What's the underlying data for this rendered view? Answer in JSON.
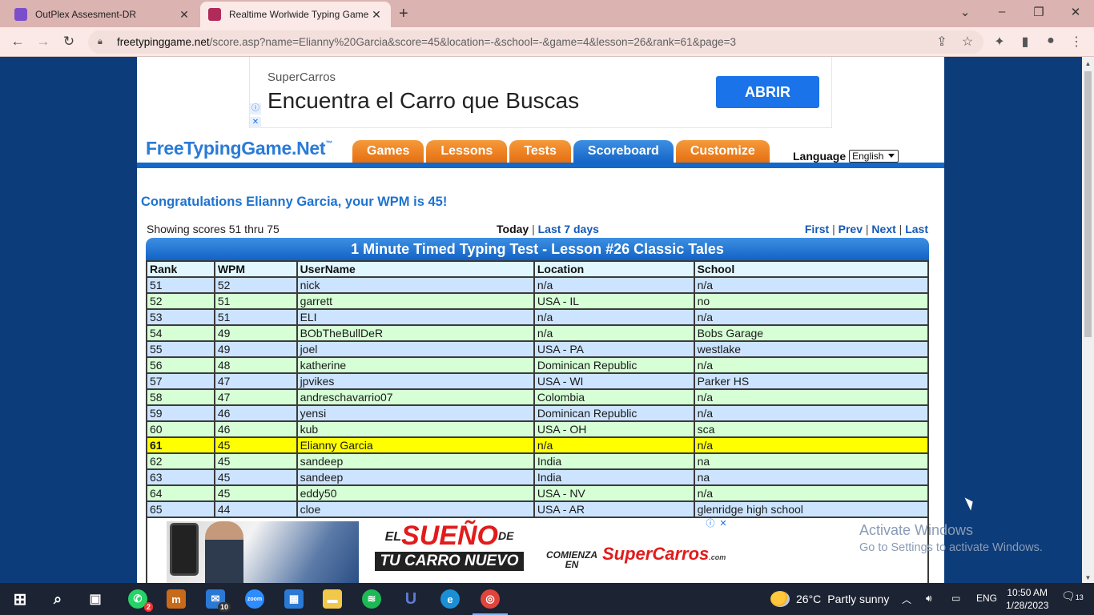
{
  "browser": {
    "tabs": [
      {
        "title": "OutPlex Assesment-DR",
        "active": false,
        "color": "#7b4fc9"
      },
      {
        "title": "Realtime Worlwide Typing Game",
        "active": true,
        "color": "#b02a5a"
      }
    ],
    "url_host": "freetypinggame.net",
    "url_path": "/score.asp?name=Elianny%20Garcia&score=45&location=-&school=-&game=4&lesson=26&rank=61&page=3"
  },
  "top_ad": {
    "brand": "SuperCarros",
    "headline": "Encuentra el Carro que Buscas",
    "cta": "ABRIR"
  },
  "site": {
    "logo": "FreeTypingGame.Net",
    "logo_tm": "™",
    "nav": [
      "Games",
      "Lessons",
      "Tests",
      "Scoreboard",
      "Customize"
    ],
    "active_nav": "Scoreboard",
    "language_label": "Language",
    "language_value": "English"
  },
  "congrats": "Congratulations Elianny Garcia, your WPM is 45!",
  "info": {
    "showing": "Showing scores 51 thru 75",
    "today": "Today",
    "sep": "|",
    "last7": "Last 7 days",
    "first": "First",
    "prev": "Prev",
    "next": "Next",
    "last": "Last"
  },
  "table": {
    "title": "1 Minute Timed Typing Test - Lesson #26 Classic Tales",
    "headers": [
      "Rank",
      "WPM",
      "UserName",
      "Location",
      "School"
    ],
    "rows": [
      [
        "51",
        "52",
        "nick",
        "n/a",
        "n/a"
      ],
      [
        "52",
        "51",
        "garrett",
        "USA - IL",
        "no"
      ],
      [
        "53",
        "51",
        "ELI",
        "n/a",
        "n/a"
      ],
      [
        "54",
        "49",
        "BObTheBullDeR",
        "n/a",
        "Bobs Garage"
      ],
      [
        "55",
        "49",
        "joel",
        "USA - PA",
        "westlake"
      ],
      [
        "56",
        "48",
        "katherine",
        "Dominican Republic",
        "n/a"
      ],
      [
        "57",
        "47",
        "jpvikes",
        "USA - WI",
        "Parker HS"
      ],
      [
        "58",
        "47",
        "andreschavarrio07",
        "Colombia",
        "n/a"
      ],
      [
        "59",
        "46",
        "yensi",
        "Dominican Republic",
        "n/a"
      ],
      [
        "60",
        "46",
        "kub",
        "USA - OH",
        "sca"
      ],
      [
        "61",
        "45",
        "Elianny Garcia",
        "n/a",
        "n/a"
      ],
      [
        "62",
        "45",
        "sandeep",
        "India",
        "na"
      ],
      [
        "63",
        "45",
        "sandeep",
        "India",
        "na"
      ],
      [
        "64",
        "45",
        "eddy50",
        "USA - NV",
        "n/a"
      ],
      [
        "65",
        "44",
        "cloe",
        "USA - AR",
        "glenridge high school"
      ]
    ],
    "highlight_rank": "61"
  },
  "bottom_ad": {
    "el": "EL",
    "sueno": "SUEÑO",
    "de": "DE",
    "line2": "TU CARRO NUEVO",
    "comienza": "COMIENZA",
    "en": "EN",
    "brand": "SuperCarros",
    "brand_suffix": ".com"
  },
  "watermark": {
    "line1": "Activate Windows",
    "line2": "Go to Settings to activate Windows."
  },
  "taskbar": {
    "whatsapp_badge": "2",
    "mail_badge": "10",
    "zoom_label": "zoom",
    "weather_temp": "26°C",
    "weather_desc": "Partly sunny",
    "lang": "ENG",
    "time": "10:50 AM",
    "date": "1/28/2023",
    "notif_count": "13"
  }
}
